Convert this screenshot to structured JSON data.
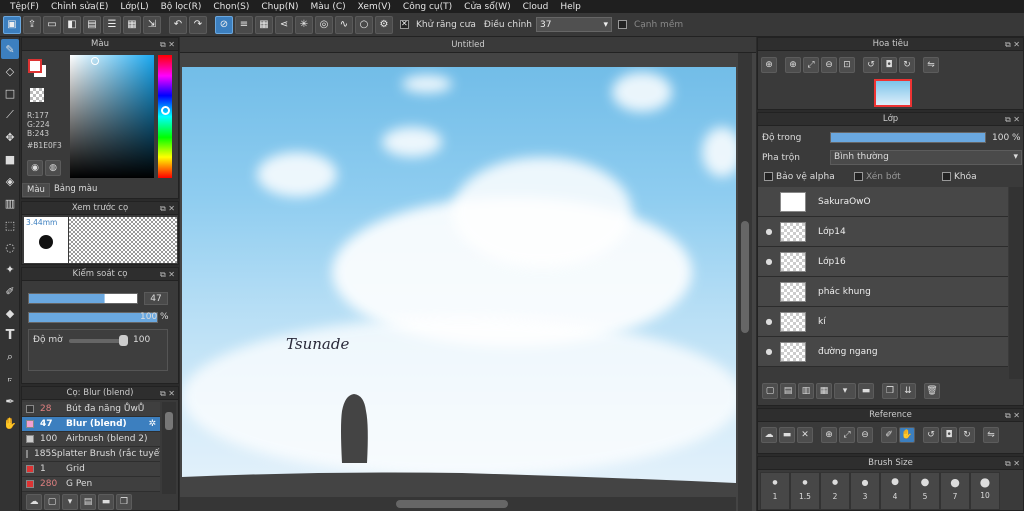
{
  "menu": [
    "Tệp(F)",
    "Chỉnh sửa(E)",
    "Lớp(L)",
    "Bộ lọc(R)",
    "Chọn(S)",
    "Chụp(N)",
    "Màu (C)",
    "Xem(V)",
    "Công cụ(T)",
    "Cửa sổ(W)",
    "Cloud",
    "Help"
  ],
  "toolbar": {
    "antialias_label": "Khử răng cưa",
    "adjust_label": "Điều chỉnh",
    "adjust_value": "37",
    "soft_edge_label": "Cạnh mềm"
  },
  "color_panel": {
    "title": "Màu",
    "r": "R:177",
    "g": "G:224",
    "b": "B:243",
    "hex": "#B1E0F3",
    "tab_color": "Màu",
    "tab_palette": "Bảng màu",
    "current_color": "#B1E0F3"
  },
  "brush_preview": {
    "title": "Xem trước cọ",
    "size": "3.44mm"
  },
  "brush_control": {
    "title": "Kiểm soát cọ",
    "size_value": "47",
    "size_level": 0.7,
    "opacity_level": 1.0,
    "opacity_value": "100 %",
    "blur_label": "Độ mờ",
    "blur_value": "100"
  },
  "brush_list": {
    "title": "Cọ: Blur (blend)",
    "items": [
      {
        "num": "28",
        "name": "Bút đa năng ŮwŮ",
        "color": "#333333"
      },
      {
        "num": "47",
        "name": "Blur (blend)",
        "color": "#f4a0d0"
      },
      {
        "num": "100",
        "name": "Airbrush (blend 2)",
        "color": "#cccccc"
      },
      {
        "num": "185",
        "name": "Splatter Brush (rắc tuyết)",
        "color": "#3355dd"
      },
      {
        "num": "1",
        "name": "Grid",
        "color": "#dd3333"
      },
      {
        "num": "280",
        "name": "G Pen",
        "color": "#dd3333"
      }
    ]
  },
  "canvas": {
    "tab": "Untitled",
    "signature": "Tsunade"
  },
  "navigator": {
    "title": "Hoa tiêu"
  },
  "layers": {
    "title": "Lớp",
    "opacity_label": "Độ trong",
    "opacity_value": "100 %",
    "opacity_level": 1.0,
    "blend_label": "Pha trộn",
    "blend_value": "Bình thường",
    "protect_alpha": "Bảo vệ alpha",
    "clipping": "Xén bớt",
    "lock": "Khóa",
    "items": [
      {
        "name": "SakuraOwO",
        "visible": false
      },
      {
        "name": "Lớp14",
        "visible": true
      },
      {
        "name": "Lớp16",
        "visible": true
      },
      {
        "name": "phác khung",
        "visible": false
      },
      {
        "name": "kí",
        "visible": true
      },
      {
        "name": "đường ngang",
        "visible": true
      }
    ]
  },
  "reference": {
    "title": "Reference"
  },
  "brush_size": {
    "title": "Brush Size",
    "sizes": [
      "1",
      "1.5",
      "2",
      "3",
      "4",
      "5",
      "7",
      "10"
    ]
  }
}
